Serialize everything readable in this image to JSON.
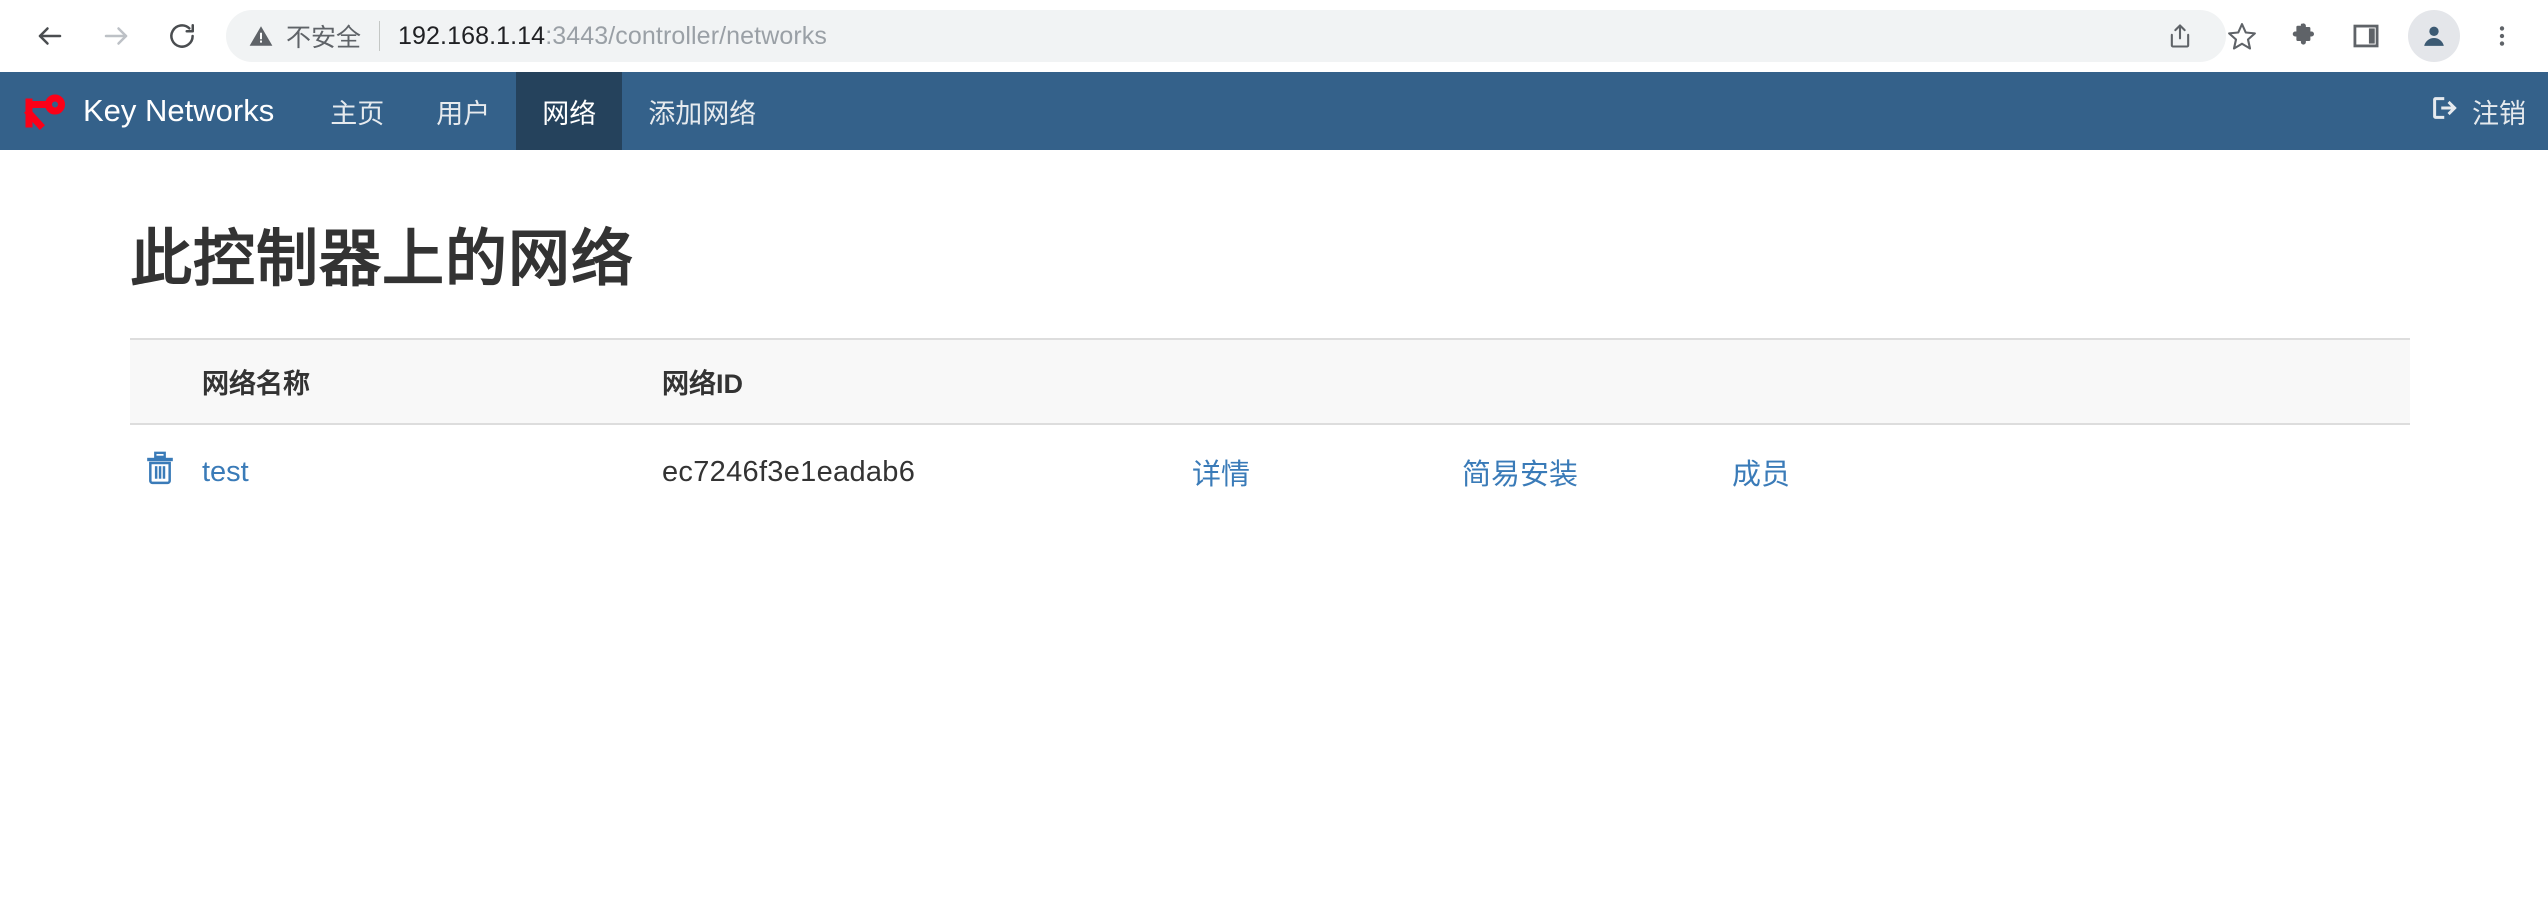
{
  "browser": {
    "back_label": "back-arrow",
    "forward_label": "forward-arrow",
    "reload_label": "reload",
    "security_text": "不安全",
    "url_host": "192.168.1.14",
    "url_path": ":3443/controller/networks",
    "url_full": "192.168.1.14:3443/controller/networks",
    "actions": [
      {
        "name": "share-icon",
        "label": "分享"
      },
      {
        "name": "bookmark-star-icon",
        "label": "收藏"
      },
      {
        "name": "extensions-puzzle-icon",
        "label": "扩展程序"
      },
      {
        "name": "side-panel-icon",
        "label": "侧边栏"
      },
      {
        "name": "profile-avatar-icon",
        "label": "个人资料"
      },
      {
        "name": "three-dot-menu-icon",
        "label": "自定义及控制"
      }
    ]
  },
  "navbar": {
    "brand": "Key Networks",
    "brand_icon": "key-icon",
    "accent_color": "#34618a",
    "active_color": "#25425c",
    "links": [
      {
        "label": "主页",
        "active": false
      },
      {
        "label": "用户",
        "active": false
      },
      {
        "label": "网络",
        "active": true
      },
      {
        "label": "添加网络",
        "active": false
      }
    ],
    "logout_label": "注销",
    "logout_icon": "sign-out-icon"
  },
  "page": {
    "title": "此控制器上的网络"
  },
  "table": {
    "headers": {
      "delete": "",
      "name": "网络名称",
      "id": "网络ID",
      "details": "",
      "install": "",
      "members": ""
    },
    "rows": [
      {
        "delete_icon": "trash-icon",
        "name": "test",
        "id": "ec7246f3e1eadab6",
        "details_label": "详情",
        "install_label": "简易安装",
        "members_label": "成员"
      }
    ],
    "link_color": "#3a7bb8"
  }
}
